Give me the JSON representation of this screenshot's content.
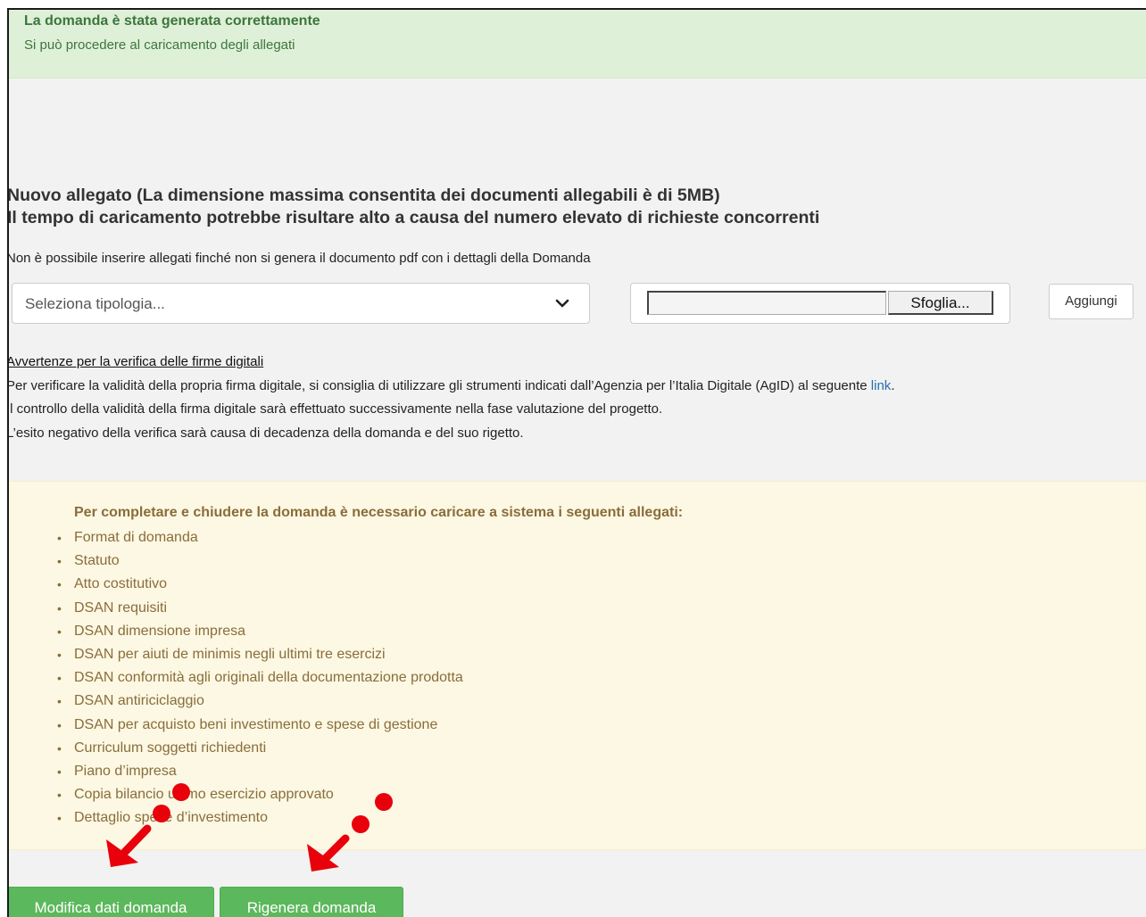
{
  "success": {
    "title": "La domanda è stata generata correttamente",
    "subtitle": "Si può procedere al caricamento degli allegati"
  },
  "upload": {
    "heading_line1": "Nuovo allegato (La dimensione massima consentita dei documenti allegabili è di 5MB)",
    "heading_line2": "Il tempo di caricamento potrebbe risultare alto a causa del numero elevato di richieste concorrenti",
    "note": "Non è possibile inserire allegati finché non si genera il documento pdf con i dettagli della Domanda",
    "select_placeholder": "Seleziona tipologia...",
    "browse_label": "Sfoglia...",
    "add_label": "Aggiungi"
  },
  "warnings": {
    "title": "Avvertenze per la verifica delle firme digitali",
    "line1": "Per verificare la validità della propria firma digitale, si consiglia di utilizzare gli strumenti indicati dall’Agenzia per l’Italia Digitale (AgID) al seguente ",
    "link_label": "link",
    "line1_end": ".",
    "line2": "Il controllo della validità della firma digitale sarà effettuato successivamente nella fase valutazione del progetto.",
    "line3": "L’esito negativo della verifica sarà causa di decadenza della domanda e del suo rigetto."
  },
  "required": {
    "title": "Per completare e chiudere la domanda è necessario caricare a sistema i seguenti allegati:",
    "bullet": "•",
    "items": [
      "Format di domanda",
      "Statuto",
      "Atto costitutivo",
      "DSAN requisiti",
      "DSAN dimensione impresa",
      "DSAN per aiuti de minimis negli ultimi tre esercizi",
      "DSAN conformità agli originali della documentazione prodotta",
      "DSAN antiriciclaggio",
      "DSAN per acquisto beni investimento e spese di gestione",
      "Curriculum soggetti richiedenti",
      "Piano d’impresa",
      "Copia bilancio ultimo esercizio approvato",
      "Dettaglio spese d’investimento"
    ]
  },
  "actions": {
    "modify_label": "Modifica dati domanda",
    "regenerate_label": "Rigenera domanda"
  },
  "colors": {
    "success_bg": "#dff0d8",
    "success_text": "#3c763d",
    "warning_bg": "#fcf8e3",
    "warning_text": "#8a6d3b",
    "button_green": "#5cb85c",
    "annotation_red": "#e8000b",
    "link": "#2a6db0"
  },
  "icons": {
    "select_arrow": "chevron-down-icon",
    "annotation": "red-arrow-icon"
  }
}
